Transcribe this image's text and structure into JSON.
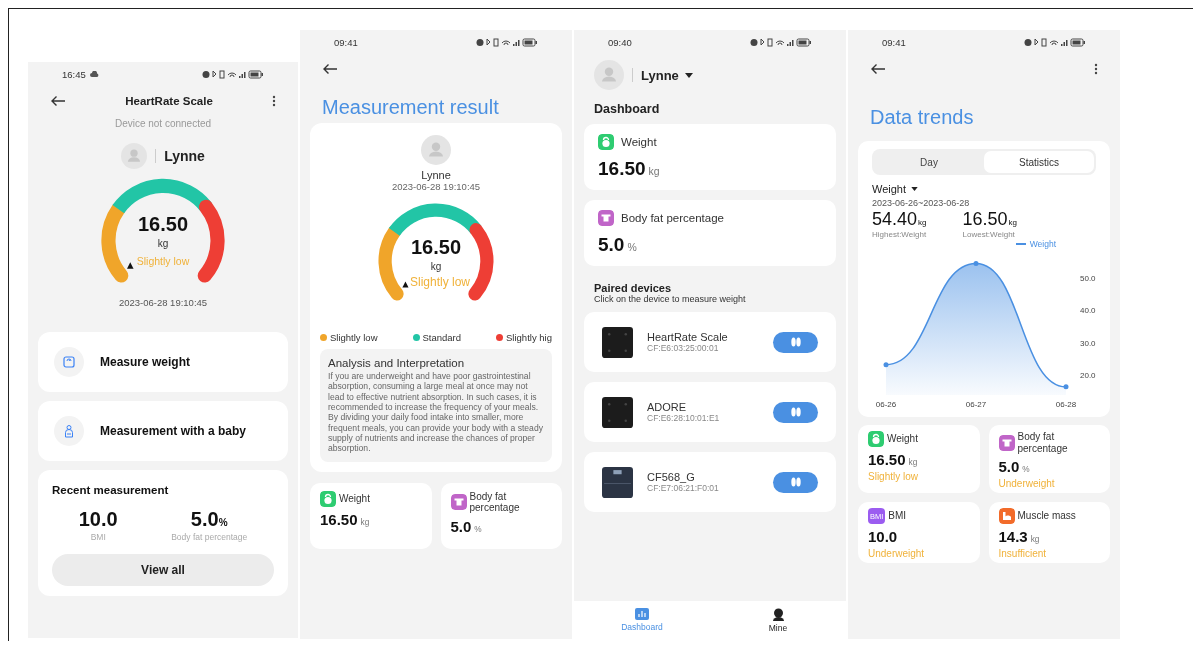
{
  "device_screen": {
    "status_bar": {
      "time": "16:45"
    },
    "title": "HeartRate Scale",
    "connection": "Device not connected",
    "user": "Lynne",
    "gauge": {
      "value": "16.50",
      "unit": "kg",
      "status": "Slightly low"
    },
    "timestamp": "2023-06-28 19:10:45",
    "actions": [
      {
        "kind": "scale",
        "label": "Measure weight"
      },
      {
        "kind": "baby",
        "label": "Measurement with a baby"
      }
    ],
    "recent": {
      "title": "Recent measurement",
      "metrics": [
        {
          "value": "10.0",
          "label": "BMI"
        },
        {
          "value": "5.0",
          "unit": "%",
          "label": "Body fat percentage"
        }
      ],
      "button": "View all"
    }
  },
  "result_screen": {
    "status_bar": {
      "time": "09:41"
    },
    "title": "Measurement result",
    "user": "Lynne",
    "timestamp": "2023-06-28 19:10:45",
    "gauge": {
      "value": "16.50",
      "unit": "kg",
      "status": "Slightly low"
    },
    "legend": [
      {
        "label": "Slightly low",
        "color": "#f0a52a"
      },
      {
        "label": "Standard",
        "color": "#22c5a6"
      },
      {
        "label": "Slightly hig",
        "color": "#ee3e35"
      }
    ],
    "analysis": {
      "title": "Analysis and Interpretation",
      "text": "If you are underweight and have poor gastrointestinal absorption, consuming a large meal at once may not lead to effective nutrient absorption. In such cases, it is recommended to increase the frequency of your meals. By dividing your daily food intake into smaller, more frequent meals, you can provide your body with a steady supply of nutrients and increase the chances of proper absorption."
    },
    "cards": [
      {
        "kind": "weight",
        "label": "Weight",
        "value": "16.50",
        "unit": "kg"
      },
      {
        "kind": "body_fat",
        "label": "Body fat percentage",
        "value": "5.0",
        "unit": "%"
      }
    ]
  },
  "dashboard_screen": {
    "status_bar": {
      "time": "09:40"
    },
    "user": "Lynne",
    "title": "Dashboard",
    "cards": [
      {
        "kind": "weight",
        "label": "Weight",
        "value": "16.50",
        "unit": "kg"
      },
      {
        "kind": "body_fat",
        "label": "Body fat percentage",
        "value": "5.0",
        "unit": "%"
      }
    ],
    "devices_title": "Paired devices",
    "devices_hint": "Click on the device to measure weight",
    "devices": [
      {
        "kind": "square",
        "name": "HeartRate Scale",
        "address": "CF:E6:03:25:00:01"
      },
      {
        "kind": "square",
        "name": "ADORE",
        "address": "CF:E6:28:10:01:E1"
      },
      {
        "kind": "display",
        "name": "CF568_G",
        "address": "CF:E7:06:21:F0:01"
      }
    ],
    "nav": [
      {
        "kind": "dashboard",
        "label": "Dashboard",
        "selected": true
      },
      {
        "kind": "mine",
        "label": "Mine",
        "selected": false
      }
    ]
  },
  "trends_screen": {
    "status_bar": {
      "time": "09:41"
    },
    "title": "Data trends",
    "tabs": [
      {
        "label": "Day",
        "selected": false
      },
      {
        "label": "Statistics",
        "selected": true
      }
    ],
    "metric": "Weight",
    "range": "2023-06-26~2023-06-28",
    "stats": [
      {
        "value": "54.40",
        "unit": "kg",
        "label": "Highest:Weight"
      },
      {
        "value": "16.50",
        "unit": "kg",
        "label": "Lowest:Weight"
      }
    ],
    "chart_data": {
      "type": "area",
      "categories": [
        "06-26",
        "06-27",
        "06-28"
      ],
      "series": [
        {
          "name": "Weight",
          "color": "#4a90e2",
          "values": [
            23.3,
            54.4,
            16.5
          ]
        }
      ],
      "ylim": [
        14,
        57
      ],
      "yticks": [
        {
          "value": 20,
          "label": "20.0"
        },
        {
          "value": 30,
          "label": "30.0"
        },
        {
          "value": 40,
          "label": "40.0"
        },
        {
          "value": 50,
          "label": "50.0"
        }
      ]
    },
    "cards": [
      {
        "kind": "weight",
        "label": "Weight",
        "value": "16.50",
        "unit": "kg",
        "status": "Slightly low"
      },
      {
        "kind": "body_fat",
        "label": "Body fat percentage",
        "value": "5.0",
        "unit": "%",
        "status": "Underweight"
      },
      {
        "kind": "bmi",
        "badge": "BMI",
        "label": "BMI",
        "value": "10.0",
        "status": "Underweight"
      },
      {
        "kind": "muscle",
        "label": "Muscle mass",
        "value": "14.3",
        "unit": "kg",
        "status": "Insufficient"
      }
    ]
  }
}
